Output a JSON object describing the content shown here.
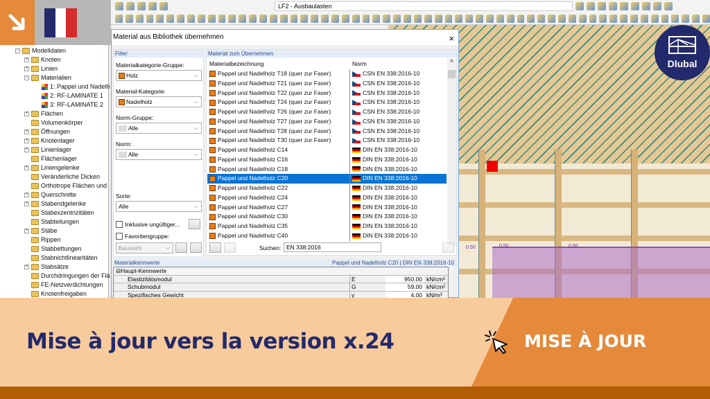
{
  "toolbar": {
    "load_case": "LF2 - Ausbaulasten"
  },
  "tree": {
    "root": "Modelldaten",
    "items": [
      {
        "label": "Knoten",
        "type": "folder",
        "expand": true
      },
      {
        "label": "Linien",
        "type": "folder",
        "expand": true
      },
      {
        "label": "Materialien",
        "type": "folder",
        "expand": "open"
      },
      {
        "label": "1: Pappel und Nadelh",
        "type": "mat",
        "child": true
      },
      {
        "label": "2: RF-LAMINATE 1",
        "type": "mat",
        "child": true
      },
      {
        "label": "3: RF-LAMINATE 2",
        "type": "mat",
        "child": true
      },
      {
        "label": "Flächen",
        "type": "folder",
        "expand": true
      },
      {
        "label": "Volumenkörper",
        "type": "folder"
      },
      {
        "label": "Öffnungen",
        "type": "folder",
        "expand": true
      },
      {
        "label": "Knotenlager",
        "type": "folder",
        "expand": true
      },
      {
        "label": "Linienlager",
        "type": "folder",
        "expand": true
      },
      {
        "label": "Flächenlager",
        "type": "folder"
      },
      {
        "label": "Liniengelenke",
        "type": "folder",
        "expand": true
      },
      {
        "label": "Veränderliche Dicken",
        "type": "folder"
      },
      {
        "label": "Orthotrope Flächen und",
        "type": "folder"
      },
      {
        "label": "Querschnitte",
        "type": "folder",
        "expand": true
      },
      {
        "label": "Stabendgelenke",
        "type": "folder",
        "expand": true
      },
      {
        "label": "Stabexzentrizitäten",
        "type": "folder"
      },
      {
        "label": "Stabteilungen",
        "type": "folder"
      },
      {
        "label": "Stäbe",
        "type": "folder",
        "expand": true
      },
      {
        "label": "Rippen",
        "type": "folder"
      },
      {
        "label": "Stabbettungen",
        "type": "folder"
      },
      {
        "label": "Stabnichtlinearitäten",
        "type": "folder"
      },
      {
        "label": "Stabsätze",
        "type": "folder",
        "expand": true
      },
      {
        "label": "Durchdringungen der Flä",
        "type": "folder"
      },
      {
        "label": "FE-Netzverdichtungen",
        "type": "folder"
      },
      {
        "label": "Knotenfreigaben",
        "type": "folder"
      }
    ]
  },
  "dialog": {
    "title": "Material aus Bibliothek übernehmen",
    "close": "×",
    "filter": {
      "heading": "Filter",
      "cat_group_label": "Materialkategorie-Gruppe:",
      "cat_group": "Holz",
      "cat_label": "Material-Kategorie:",
      "cat": "Nadelholz",
      "norm_group_label": "Norm-Gruppe:",
      "norm_group": "Alle",
      "norm_label": "Norm:",
      "norm": "Alle",
      "sort_label": "Sorte:",
      "sort": "Alle",
      "invalid_label": "Inklusive ungültiger...",
      "fav_label": "Favoritengruppe:",
      "fav": "Baustahl"
    },
    "list": {
      "heading": "Material zum Übernehmen",
      "col_name": "Materialbezeichnung",
      "col_norm": "Norm",
      "rows": [
        {
          "name": "Pappel und Nadelholz T18 (quer zur Faser)",
          "norm": "CSN EN 338:2016-10",
          "flag": "cz"
        },
        {
          "name": "Pappel und Nadelholz T21 (quer zur Faser)",
          "norm": "CSN EN 338:2016-10",
          "flag": "cz"
        },
        {
          "name": "Pappel und Nadelholz T22 (quer zur Faser)",
          "norm": "CSN EN 338:2016-10",
          "flag": "cz"
        },
        {
          "name": "Pappel und Nadelholz T24 (quer zur Faser)",
          "norm": "CSN EN 338:2016-10",
          "flag": "cz"
        },
        {
          "name": "Pappel und Nadelholz T26 (quer zur Faser)",
          "norm": "CSN EN 338:2016-10",
          "flag": "cz"
        },
        {
          "name": "Pappel und Nadelholz T27 (quer zur Faser)",
          "norm": "CSN EN 338:2016-10",
          "flag": "cz"
        },
        {
          "name": "Pappel und Nadelholz T28 (quer zur Faser)",
          "norm": "CSN EN 338:2016-10",
          "flag": "cz"
        },
        {
          "name": "Pappel und Nadelholz T30 (quer zur Faser)",
          "norm": "CSN EN 338:2016-10",
          "flag": "cz"
        },
        {
          "name": "Pappel und Nadelholz C14",
          "norm": "DIN EN 338:2016-10",
          "flag": "de"
        },
        {
          "name": "Pappel und Nadelholz C16",
          "norm": "DIN EN 338:2016-10",
          "flag": "de"
        },
        {
          "name": "Pappel und Nadelholz C18",
          "norm": "DIN EN 338:2016-10",
          "flag": "de"
        },
        {
          "name": "Pappel und Nadelholz C20",
          "norm": "DIN EN 338:2016-10",
          "flag": "de",
          "selected": true
        },
        {
          "name": "Pappel und Nadelholz C22",
          "norm": "DIN EN 338:2016-10",
          "flag": "de"
        },
        {
          "name": "Pappel und Nadelholz C24",
          "norm": "DIN EN 338:2016-10",
          "flag": "de"
        },
        {
          "name": "Pappel und Nadelholz C27",
          "norm": "DIN EN 338:2016-10",
          "flag": "de"
        },
        {
          "name": "Pappel und Nadelholz C30",
          "norm": "DIN EN 338:2016-10",
          "flag": "de"
        },
        {
          "name": "Pappel und Nadelholz C35",
          "norm": "DIN EN 338:2016-10",
          "flag": "de"
        },
        {
          "name": "Pappel und Nadelholz C40",
          "norm": "DIN EN 338:2016-10",
          "flag": "de"
        }
      ],
      "search_label": "Suchen:",
      "search_value": "EN 338:2016"
    },
    "props": {
      "heading": "Materialkennwerte",
      "selected": "Pappel und Nadelholz C20  |  DIN EN 338:2016-10",
      "group": "Haupt-Kennwerte",
      "rows": [
        {
          "name": "Elastizitätsmodul",
          "sym": "E",
          "val": "950.00",
          "unit": "kN/cm²"
        },
        {
          "name": "Schubmodul",
          "sym": "G",
          "val": "59.00",
          "unit": "kN/cm²"
        },
        {
          "name": "Spezifisches Gewicht",
          "sym": "γ",
          "val": "4.00",
          "unit": "kN/m³"
        }
      ]
    }
  },
  "model": {
    "load_label1": "0.50",
    "load_label2": "0.50",
    "load_label3": "0.50"
  },
  "logo": {
    "text": "Dlubal"
  },
  "banner": {
    "title": "Mise à jour vers la version x.24",
    "cta": "MISE À JOUR"
  },
  "colors": {
    "orange": "#e5893b",
    "peach": "#f8cb9d",
    "navy": "#232a6b",
    "strip": "#b35e06",
    "select": "#0a73d3"
  }
}
